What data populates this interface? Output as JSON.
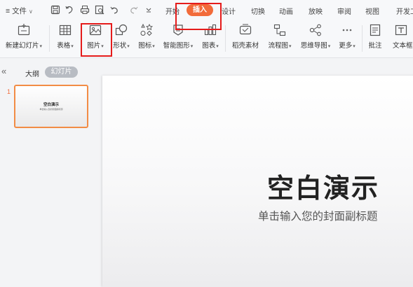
{
  "menubar": {
    "file_label": "文件",
    "tabs": [
      "开始",
      "插入",
      "设计",
      "切换",
      "动画",
      "放映",
      "审阅",
      "视图",
      "开发工"
    ]
  },
  "ribbon": {
    "new_slide": "新建幻灯片",
    "table": "表格",
    "picture": "图片",
    "shape": "形状",
    "icon": "图标",
    "smart_art": "智能图形",
    "chart": "图表",
    "docer_material": "稻壳素材",
    "flowchart": "流程图",
    "mindmap": "思维导图",
    "more": "更多",
    "comment": "批注",
    "textbox": "文本框"
  },
  "leftpane": {
    "outline_tab": "大纲",
    "slides_tab": "幻灯片",
    "slide_number": "1",
    "thumb_title": "空白演示",
    "thumb_subtitle": "单击输入您的封面副标题"
  },
  "slide": {
    "title": "空白演示",
    "subtitle": "单击输入您的封面副标题"
  },
  "colors": {
    "accent": "#f26b3a",
    "highlight_box": "#e51b1b"
  }
}
